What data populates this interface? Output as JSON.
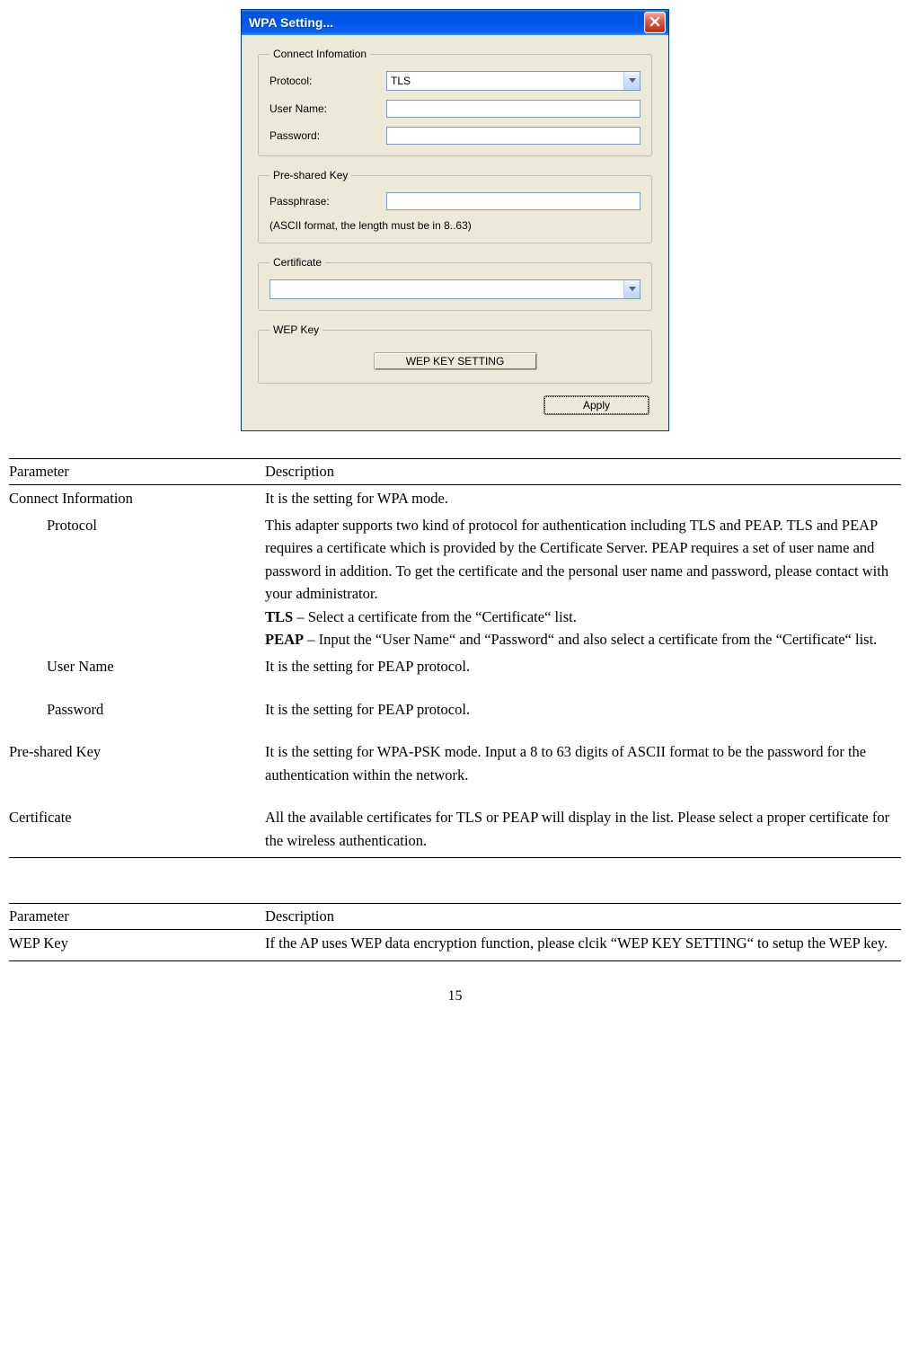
{
  "dialog": {
    "title": "WPA Setting...",
    "connect_info": {
      "legend": "Connect Infomation",
      "protocol_label": "Protocol:",
      "protocol_value": "TLS",
      "username_label": "User Name:",
      "username_value": "",
      "password_label": "Password:",
      "password_value": ""
    },
    "psk": {
      "legend": "Pre-shared Key",
      "passphrase_label": "Passphrase:",
      "passphrase_value": "",
      "hint": "(ASCII format, the length must be in 8..63)"
    },
    "cert": {
      "legend": "Certificate",
      "value": ""
    },
    "wep": {
      "legend": "WEP Key",
      "button": "WEP KEY SETTING"
    },
    "apply": "Apply"
  },
  "table1": {
    "header_param": "Parameter",
    "header_desc": "Description",
    "rows": {
      "connect_info": "Connect Information",
      "connect_info_desc": "It is the setting for WPA mode.",
      "protocol": "Protocol",
      "protocol_desc1": "This adapter supports two kind of protocol for authentication including TLS and PEAP. TLS and PEAP requires a certificate which is provided by the Certificate Server. PEAP requires a set of user name and password in addition. To get the certificate and the personal user name and password, please contact with your administrator.",
      "protocol_tls_b": "TLS",
      "protocol_tls_t": " – Select a certificate from the “Certificate“ list.",
      "protocol_peap_b": "PEAP",
      "protocol_peap_t": " – Input the “User Name“ and “Password“ and also select a certificate from the “Certificate“ list.",
      "username": "User Name",
      "username_desc": "It is the setting for PEAP protocol.",
      "password": "Password",
      "password_desc": "It is the setting for PEAP protocol.",
      "psk": "Pre-shared Key",
      "psk_desc": "It is the setting for WPA-PSK mode. Input a 8 to 63 digits of ASCII format to be the password for the authentication within the network.",
      "cert": "Certificate",
      "cert_desc": "All the available certificates for TLS or PEAP will display in the list. Please select a proper certificate for the wireless authentication."
    }
  },
  "table2": {
    "header_param": "Parameter",
    "header_desc": "Description",
    "wep": "WEP Key",
    "wep_desc": "If the AP uses WEP data encryption function, please clcik “WEP KEY SETTING“ to setup the WEP key."
  },
  "page_number": "15"
}
